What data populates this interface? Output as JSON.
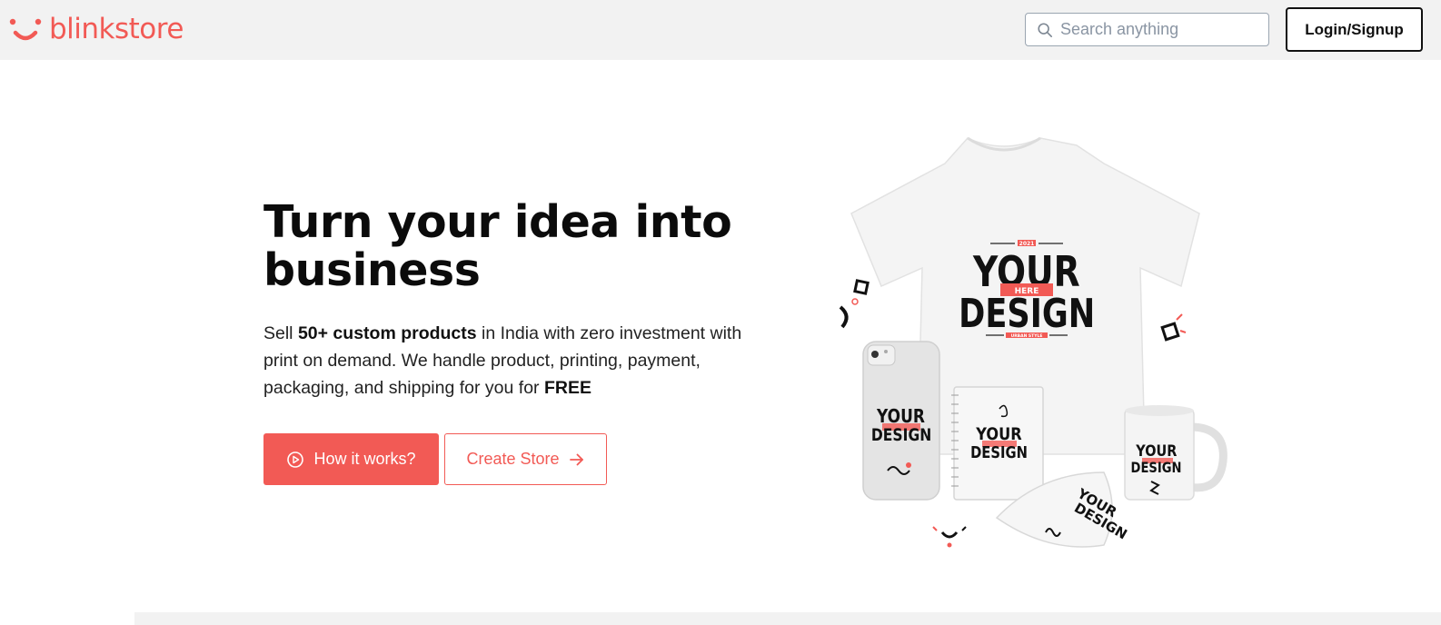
{
  "brand": {
    "name": "blinkstore",
    "color": "#f25a55"
  },
  "header": {
    "search_placeholder": "Search anything",
    "login_label": "Login/Signup"
  },
  "hero": {
    "title": "Turn your idea into business",
    "desc_pre": "Sell ",
    "desc_bold": "50+ custom products",
    "desc_mid": " in India with zero investment with print on demand. We handle product, printing, payment, packaging, and shipping for you for ",
    "desc_free": "FREE",
    "primary_button": "How it works?",
    "secondary_button": "Create Store",
    "art": {
      "tshirt_top": "2021",
      "tshirt_line1": "YOUR",
      "tshirt_ribbon": "HERE",
      "tshirt_line2": "DESIGN",
      "tshirt_bottom": "URBAN STYLE"
    }
  },
  "icons": {
    "search": "search-icon",
    "play": "play-circle-icon",
    "arrow": "arrow-right-icon"
  }
}
